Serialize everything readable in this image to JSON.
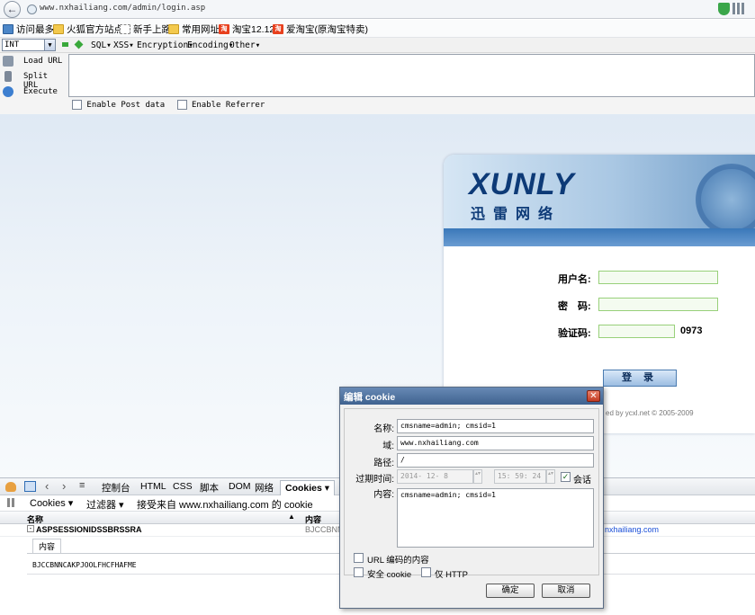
{
  "browser": {
    "url": "www.nxhailiang.com/admin/login.asp",
    "bookmarks": [
      {
        "label": "访问最多",
        "icon": "visited-icon"
      },
      {
        "label": "火狐官方站点",
        "icon": "folder-icon"
      },
      {
        "label": "新手上路",
        "icon": "page-icon"
      },
      {
        "label": "常用网址",
        "icon": "folder-icon"
      },
      {
        "label": "淘宝12.12",
        "icon": "taobao-icon"
      },
      {
        "label": "爱淘宝(原淘宝特卖)",
        "icon": "taobao-icon"
      }
    ]
  },
  "hackbar": {
    "type_select": "INT",
    "menus": [
      "SQL▾",
      "XSS▾",
      "Encryption▾",
      "Encoding▾",
      "Other▾"
    ],
    "actions": [
      "Load URL",
      "Split URL",
      "Execute"
    ],
    "enable_post": "Enable Post data",
    "enable_referrer": "Enable Referrer"
  },
  "login": {
    "logo": "XUNLY",
    "logo_cn": "迅雷网络",
    "username_label": "用户名:",
    "password_label": "密　码:",
    "captcha_label": "验证码:",
    "captcha_value": "0973",
    "submit": "登 录",
    "copyright": "ed by ycxl.net © 2005-2009"
  },
  "firebug": {
    "tabs": [
      "控制台",
      "HTML",
      "CSS",
      "脚本",
      "DOM",
      "网络"
    ],
    "active_tab": "Cookies ▾",
    "sub": {
      "cookies": "Cookies ▾",
      "filter": "过滤器 ▾",
      "source": "接受来自 www.nxhailiang.com 的 cookie"
    },
    "columns": {
      "name": "名称",
      "content": "内容"
    },
    "row": {
      "name": "ASPSESSIONIDSSBRSSRA",
      "content": "BJCCBNNC",
      "domain": "nxhailiang.com"
    },
    "detail_tab": "内容",
    "detail_value": "BJCCBNNCAKPJOOLFHCFHAFME"
  },
  "dialog": {
    "title": "编辑 cookie",
    "name_label": "名称:",
    "name_value": "cmsname=admin; cmsid=1",
    "domain_label": "域:",
    "domain_value": "www.nxhailiang.com",
    "path_label": "路径:",
    "path_value": "/",
    "expire_label": "过期时间:",
    "expire_date": "2014- 12- 8",
    "expire_time": "15: 59: 24",
    "session_label": "会话",
    "content_label": "内容:",
    "content_value": "cmsname=admin; cmsid=1",
    "url_encode": "URL 编码的内容",
    "secure": "安全 cookie",
    "http_only": "仅 HTTP",
    "ok": "确定",
    "cancel": "取消"
  }
}
